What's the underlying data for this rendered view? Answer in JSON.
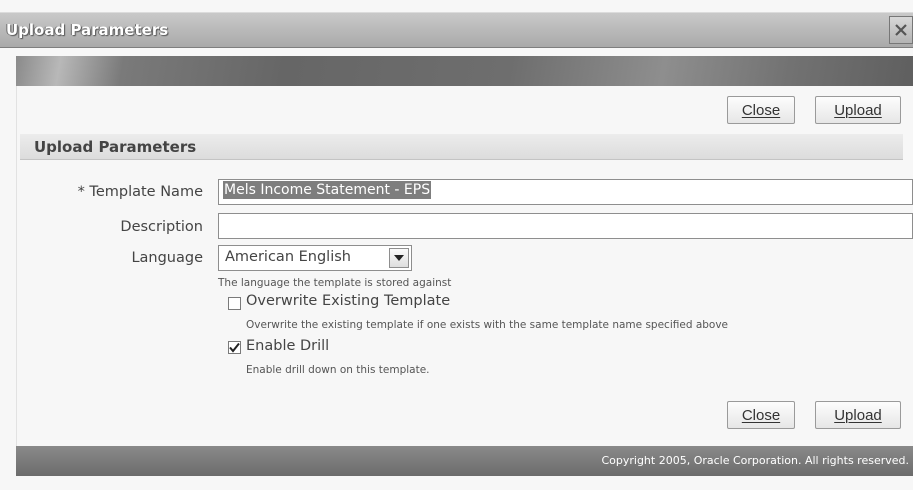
{
  "window": {
    "title": "Upload Parameters"
  },
  "toolbar_top": {
    "close_label": "Close",
    "upload_label": "Upload"
  },
  "section": {
    "title": "Upload Parameters"
  },
  "form": {
    "template_name": {
      "label": "* Template Name",
      "value": "Mels Income Statement - EPS"
    },
    "description": {
      "label": "Description",
      "value": ""
    },
    "language": {
      "label": "Language",
      "selected": "American English",
      "hint": "The language the template is stored against"
    },
    "overwrite": {
      "label": "Overwrite Existing Template",
      "checked": false,
      "hint": "Overwrite the existing template if one exists with the same template name specified above"
    },
    "enable_drill": {
      "label": "Enable Drill",
      "checked": true,
      "hint": "Enable drill down on this template."
    }
  },
  "toolbar_bottom": {
    "close_label": "Close",
    "upload_label": "Upload"
  },
  "footer": {
    "copyright": "Copyright 2005, Oracle Corporation. All rights reserved."
  },
  "icons": {
    "window_close": "close-icon",
    "dropdown": "chevron-down-icon",
    "checkmark": "checkmark-icon"
  }
}
